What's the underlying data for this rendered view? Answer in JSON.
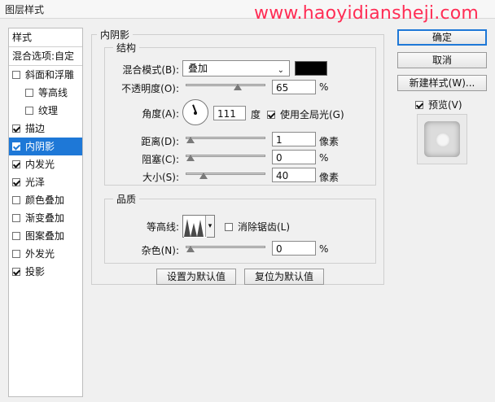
{
  "window": {
    "title": "图层样式"
  },
  "watermark": "www.haoyidiansheji.com",
  "sidebar": {
    "header": "样式",
    "blend_options": "混合选项:自定",
    "items": [
      {
        "label": "斜面和浮雕",
        "checked": false,
        "selected": false,
        "sub": false
      },
      {
        "label": "等高线",
        "checked": false,
        "selected": false,
        "sub": true
      },
      {
        "label": "纹理",
        "checked": false,
        "selected": false,
        "sub": true
      },
      {
        "label": "描边",
        "checked": true,
        "selected": false,
        "sub": false
      },
      {
        "label": "内阴影",
        "checked": true,
        "selected": true,
        "sub": false
      },
      {
        "label": "内发光",
        "checked": true,
        "selected": false,
        "sub": false
      },
      {
        "label": "光泽",
        "checked": true,
        "selected": false,
        "sub": false
      },
      {
        "label": "颜色叠加",
        "checked": false,
        "selected": false,
        "sub": false
      },
      {
        "label": "渐变叠加",
        "checked": false,
        "selected": false,
        "sub": false
      },
      {
        "label": "图案叠加",
        "checked": false,
        "selected": false,
        "sub": false
      },
      {
        "label": "外发光",
        "checked": false,
        "selected": false,
        "sub": false
      },
      {
        "label": "投影",
        "checked": true,
        "selected": false,
        "sub": false
      }
    ]
  },
  "inner_shadow": {
    "section_title": "内阴影",
    "structure": {
      "title": "结构",
      "blend_mode_label": "混合模式(B):",
      "blend_mode_value": "叠加",
      "shadow_color": "#000000",
      "opacity_label": "不透明度(O):",
      "opacity_value": "65",
      "opacity_unit": "%",
      "angle_label": "角度(A):",
      "angle_value": "111",
      "angle_unit": "度",
      "global_light_label": "使用全局光(G)",
      "global_light_checked": true,
      "distance_label": "距离(D):",
      "distance_value": "1",
      "distance_unit": "像素",
      "choke_label": "阻塞(C):",
      "choke_value": "0",
      "choke_unit": "%",
      "size_label": "大小(S):",
      "size_value": "40",
      "size_unit": "像素"
    },
    "quality": {
      "title": "品质",
      "contour_label": "等高线:",
      "anti_alias_label": "消除锯齿(L)",
      "anti_alias_checked": false,
      "noise_label": "杂色(N):",
      "noise_value": "0",
      "noise_unit": "%"
    },
    "make_default": "设置为默认值",
    "reset_default": "复位为默认值"
  },
  "right": {
    "ok": "确定",
    "cancel": "取消",
    "new_style": "新建样式(W)...",
    "preview_label": "预览(V)",
    "preview_checked": true
  }
}
